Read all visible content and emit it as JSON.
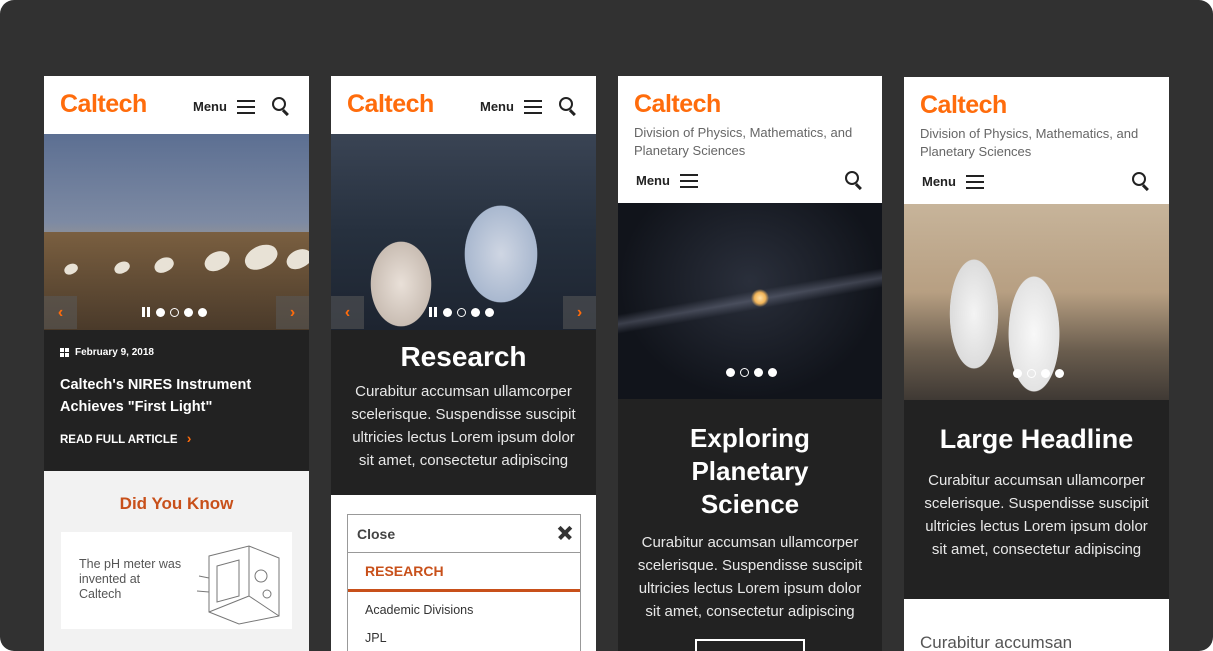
{
  "panel1": {
    "logo": "Caltech",
    "menu_label": "Menu",
    "prev_arrow": "‹",
    "next_arrow": "›",
    "date": "February 9, 2018",
    "headline": "Caltech's NIRES Instrument Achieves \"First Light\"",
    "read_more": "READ FULL ARTICLE",
    "read_more_chevron": "›",
    "did_you_know_title": "Did You Know",
    "fact_text": "The pH meter was invented at Caltech"
  },
  "panel2": {
    "logo": "Caltech",
    "menu_label": "Menu",
    "prev_arrow": "‹",
    "next_arrow": "›",
    "headline": "Research",
    "body": "Curabitur accumsan ullamcorper scelerisque. Suspendisse suscipit ultricies lectus Lorem ipsum dolor sit amet, consectetur adipiscing",
    "menu": {
      "close_label": "Close",
      "section_label": "RESEARCH",
      "items": [
        "Academic Divisions",
        "JPL"
      ]
    }
  },
  "panel3": {
    "logo": "Caltech",
    "subtitle": "Division of Physics, Mathematics, and Planetary Sciences",
    "menu_label": "Menu",
    "headline": "Exploring Planetary Science",
    "body": "Curabitur accumsan ullamcorper scelerisque. Suspendisse suscipit ultricies lectus Lorem ipsum dolor sit amet, consectetur adipiscing"
  },
  "panel4": {
    "logo": "Caltech",
    "subtitle": "Division of Physics, Mathematics, and Planetary Sciences",
    "menu_label": "Menu",
    "headline": "Large Headline",
    "body": "Curabitur accumsan ullamcorper scelerisque. Suspendisse suscipit ultricies lectus Lorem ipsum dolor sit amet, consectetur adipiscing",
    "below_text": "Curabitur accumsan"
  },
  "colors": {
    "background": "#313131",
    "brand_orange": "#ff6c0c",
    "rust": "#c8501a",
    "dark_panel": "#222222"
  }
}
